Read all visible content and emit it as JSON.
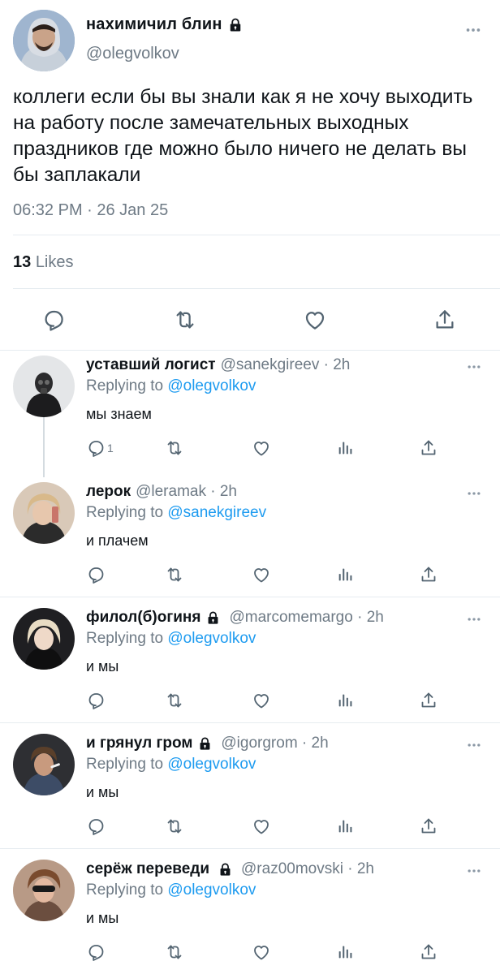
{
  "main_tweet": {
    "author_name": "нахимичил блин",
    "author_handle": "@olegvolkov",
    "text": "коллеги если бы вы знали как я не хочу выходить на работу после замечательных выходных праздников где можно было ничего не делать вы бы заплакали",
    "timestamp": "06:32 PM · 26 Jan 25",
    "likes_count": "13",
    "likes_label": "Likes"
  },
  "replies": [
    {
      "name": "уставший логист",
      "handle": "@sanekgireev · 2h",
      "replying_prefix": "Replying to",
      "replying_to": "@olegvolkov",
      "text": "мы знаем",
      "reply_count": "1",
      "locked": false
    },
    {
      "name": "лерок",
      "handle": "@leramak · 2h",
      "replying_prefix": "Replying to",
      "replying_to": "@sanekgireev",
      "text": "и плачем",
      "reply_count": "",
      "locked": false
    },
    {
      "name": "филол(б)огиня",
      "handle": "@marcomemargo · 2h",
      "replying_prefix": "Replying to",
      "replying_to": "@olegvolkov",
      "text": "и мы",
      "reply_count": "",
      "locked": true
    },
    {
      "name": "и грянул гром",
      "handle": "@igorgrom · 2h",
      "replying_prefix": "Replying to",
      "replying_to": "@olegvolkov",
      "text": "и мы",
      "reply_count": "",
      "locked": true
    },
    {
      "name": "серёж переведи",
      "handle": "@raz00movski · 2h",
      "replying_prefix": "Replying to",
      "replying_to": "@olegvolkov",
      "text": "и мы",
      "reply_count": "",
      "locked": true
    }
  ],
  "icons": {
    "reply": "reply-icon",
    "retweet": "retweet-icon",
    "like": "heart-icon",
    "views": "analytics-icon",
    "share": "share-icon",
    "more": "more-icon",
    "lock": "lock-icon"
  },
  "colors": {
    "text": "#0f1419",
    "secondary": "#6e7a85",
    "link": "#1d9bf0",
    "divider": "#e6ecf0"
  }
}
